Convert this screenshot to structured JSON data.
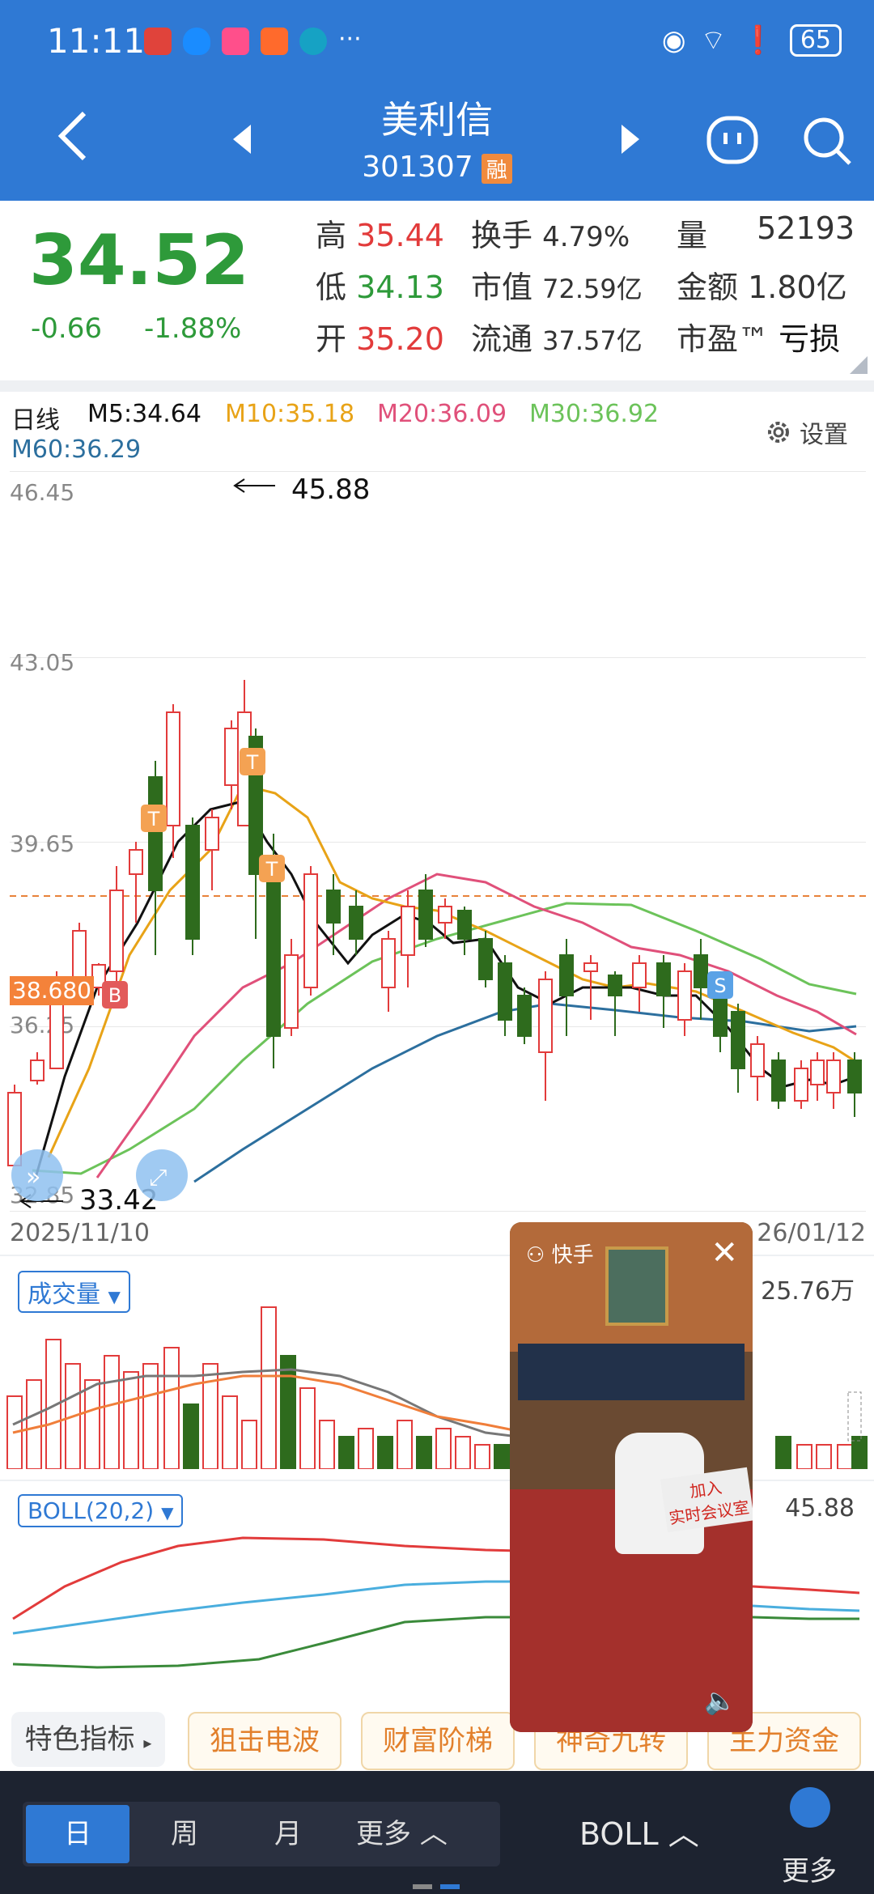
{
  "status": {
    "time": "11:11",
    "battery": "65",
    "dots": "···"
  },
  "header": {
    "name": "美利信",
    "code": "301307",
    "tag": "融"
  },
  "quote": {
    "price": "34.52",
    "change": "-0.66",
    "change_pct": "-1.88%",
    "high_label": "高",
    "high": "35.44",
    "low_label": "低",
    "low": "34.13",
    "open_label": "开",
    "open": "35.20",
    "turnover_label": "换手",
    "turnover": "4.79%",
    "mktcap_label": "市值",
    "mktcap": "72.59亿",
    "float_label": "流通",
    "float_cap": "37.57亿",
    "vol_label": "量",
    "volume": "52193",
    "amount_label": "金额",
    "amount": "1.80亿",
    "pe_label": "市盈™",
    "pe": "亏损"
  },
  "chart": {
    "period": "日线",
    "ma5": "M5:34.64",
    "ma10": "M10:35.18",
    "ma20": "M20:36.09",
    "ma30": "M30:36.92",
    "ma60": "M60:36.29",
    "settings": "设置",
    "y_labels": [
      "46.45",
      "43.05",
      "39.65",
      "36.25",
      "32.85"
    ],
    "current_line": "38.680",
    "high_mark": "45.88",
    "low_mark": "33.42",
    "start_date": "2025/11/10",
    "end_date": "26/01/12",
    "signal_T": "T",
    "signal_B": "B",
    "signal_S": "S",
    "colors": {
      "up": "#e23b3b",
      "down": "#2e6b1d",
      "ma5": "#111111",
      "ma10": "#e8a317",
      "ma20": "#e0507a",
      "ma30": "#6cc35a",
      "ma60": "#2c6f9e"
    }
  },
  "volume": {
    "label": "成交量",
    "max": "25.76万"
  },
  "boll": {
    "label": "BOLL(20,2)",
    "max": "45.88"
  },
  "feature_tabs": [
    "特色指标",
    "狙击电波",
    "财富阶梯",
    "神奇九转",
    "主力资金"
  ],
  "video": {
    "app": "快手",
    "banner": "加入",
    "banner2": "实时会议室"
  },
  "bottom": {
    "tabs": [
      "日",
      "周",
      "月",
      "更多"
    ],
    "indicator": "BOLL",
    "more": "更多"
  }
}
